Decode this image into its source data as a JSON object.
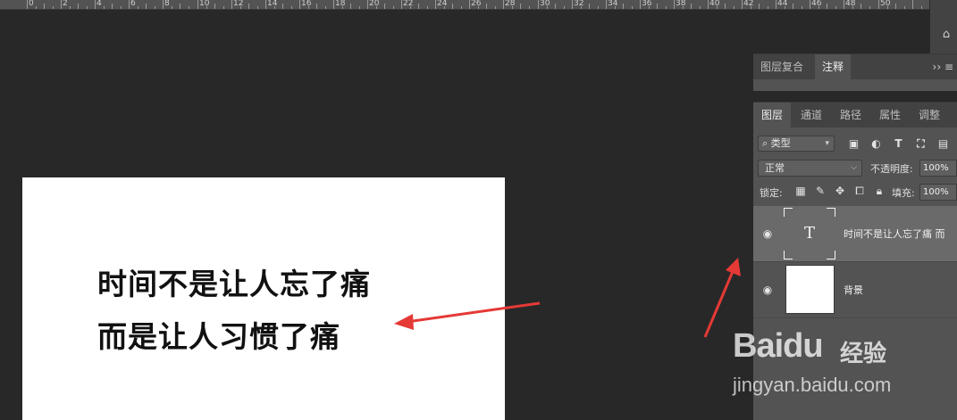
{
  "ruler": {
    "numbers": [
      "0",
      "2",
      "4",
      "6",
      "8",
      "10",
      "12",
      "14",
      "16",
      "18",
      "20",
      "22",
      "24",
      "26",
      "28",
      "30",
      "32",
      "34",
      "36",
      "38",
      "40",
      "42",
      "44",
      "46",
      "48",
      "50"
    ]
  },
  "canvas": {
    "line1": "时间不是让人忘了痛",
    "line2": "而是让人习惯了痛"
  },
  "upper_panel": {
    "tab1": "图层复合",
    "tab2": "注释",
    "menu": "›› ≡"
  },
  "layers_panel": {
    "tabs": [
      "图层",
      "通道",
      "路径",
      "属性",
      "调整"
    ],
    "filter_label": "类型",
    "filter_icon": "search-icon",
    "blend_mode": "正常",
    "opacity_label": "不透明度:",
    "opacity_value": "100%",
    "lock_label": "锁定:",
    "fill_label": "填充:",
    "fill_value": "100%",
    "layers": [
      {
        "name": "时间不是让人忘了痛 而",
        "type": "text",
        "thumb_glyph": "T",
        "selected": true
      },
      {
        "name": "背景",
        "type": "background",
        "selected": false
      }
    ]
  },
  "watermark": {
    "logo_text": "Baidu",
    "logo_cn": "经验",
    "url": "jingyan.baidu.com"
  },
  "colors": {
    "workspace": "#282828",
    "panel": "#535353",
    "tab_bar": "#424242",
    "selected_layer": "#6a6a6a",
    "arrow": "#e53935"
  }
}
